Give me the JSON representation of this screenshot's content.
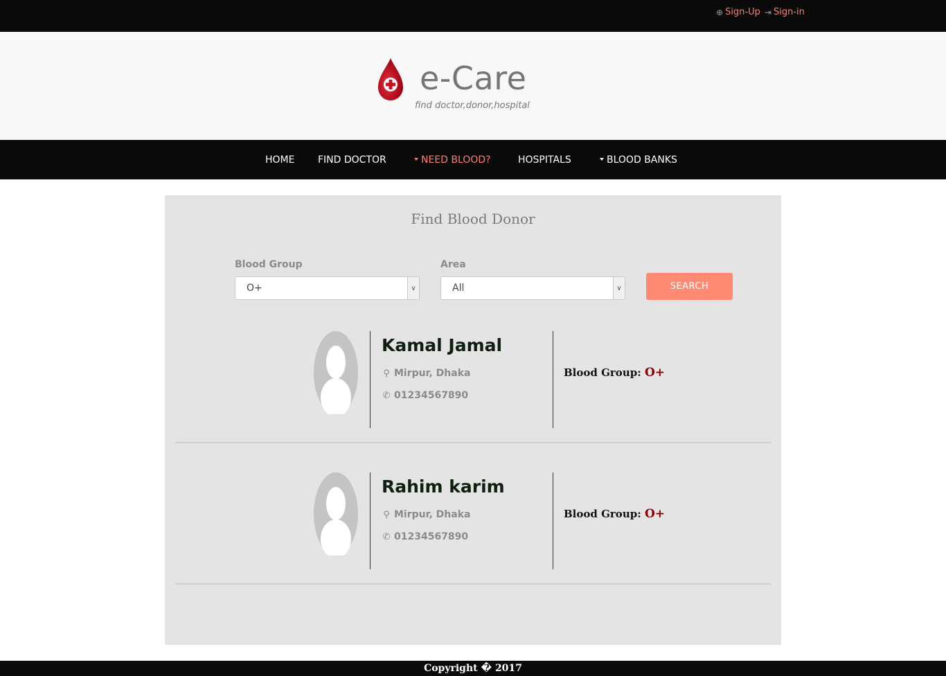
{
  "topbar": {
    "signup_label": "Sign-Up",
    "signin_label": "Sign-in",
    "link_color": "#ff7f6e"
  },
  "header": {
    "brand": "e-Care",
    "tagline": "find doctor,donor,hospital",
    "logo_color": "#c8101e"
  },
  "nav": {
    "items": [
      {
        "label": "HOME"
      },
      {
        "label": "FIND DOCTOR"
      },
      {
        "label": "NEED BLOOD?",
        "active": true,
        "dropdown": true
      },
      {
        "label": "HOSPITALS"
      },
      {
        "label": "BLOOD BANKS",
        "dropdown": true
      }
    ],
    "active_color": "#ff7f6e"
  },
  "search": {
    "title": "Find Blood Donor",
    "blood_group_label": "Blood Group",
    "blood_group_value": "O+",
    "area_label": "Area",
    "area_value": "All",
    "search_button": "SEARCH",
    "button_color": "#ff8a73"
  },
  "donors": [
    {
      "name": "Kamal Jamal",
      "location": "Mirpur, Dhaka",
      "phone": "01234567890",
      "blood_group_label": "Blood Group:",
      "blood_group": "O+"
    },
    {
      "name": "Rahim karim",
      "location": "Mirpur, Dhaka",
      "phone": "01234567890",
      "blood_group_label": "Blood Group:",
      "blood_group": "O+"
    }
  ],
  "footer": {
    "copyright": "Copyright � 2017"
  }
}
